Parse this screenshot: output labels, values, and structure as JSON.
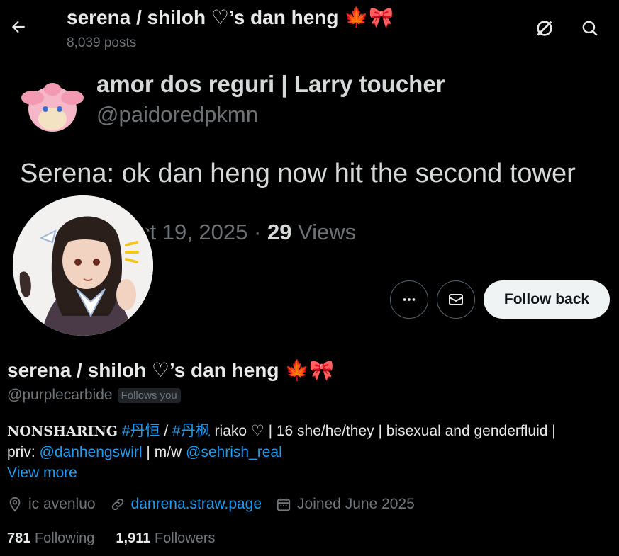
{
  "header": {
    "title": "serena / shiloh ♡’s dan heng",
    "title_emoji_1": "🍁",
    "title_emoji_2": "🎀",
    "post_count": "8,039 posts"
  },
  "banner": {
    "quoted_name": "amor dos reguri | Larry toucher",
    "quoted_handle": "@paidoredpkmn",
    "quoted_text": "Serena: ok dan heng now hit the second tower",
    "quoted_date": "ct 19, 2025 · ",
    "quoted_views_count": "29",
    "quoted_views_label": " Views"
  },
  "actions": {
    "follow_label": "Follow back"
  },
  "profile": {
    "display_name": "serena / shiloh ♡’s dan heng",
    "handle": "@purplecarbide",
    "follows_you": "Follows you",
    "bio": {
      "nonsharing": "NONSHARING",
      "tag1": "#丹恒",
      "sep1": " / ",
      "tag2": "#丹枫",
      "text1": " riako ♡ | 16 she/he/they | bisexual and genderfluid |",
      "priv_label": "priv: ",
      "link1": "@danhengswirl",
      "mw": " | m/w ",
      "link2": "@sehrish_real"
    },
    "view_more": "View more",
    "location": "ic avenluo",
    "website": "danrena.straw.page",
    "joined": "Joined June 2025",
    "following_count": "781",
    "following_label": "Following",
    "followers_count": "1,911",
    "followers_label": "Followers"
  },
  "colors": {
    "background": "#000000",
    "text": "#e7e9ea",
    "muted": "#71767b",
    "link": "#1d9bf0",
    "button_bg": "#eff3f4"
  }
}
